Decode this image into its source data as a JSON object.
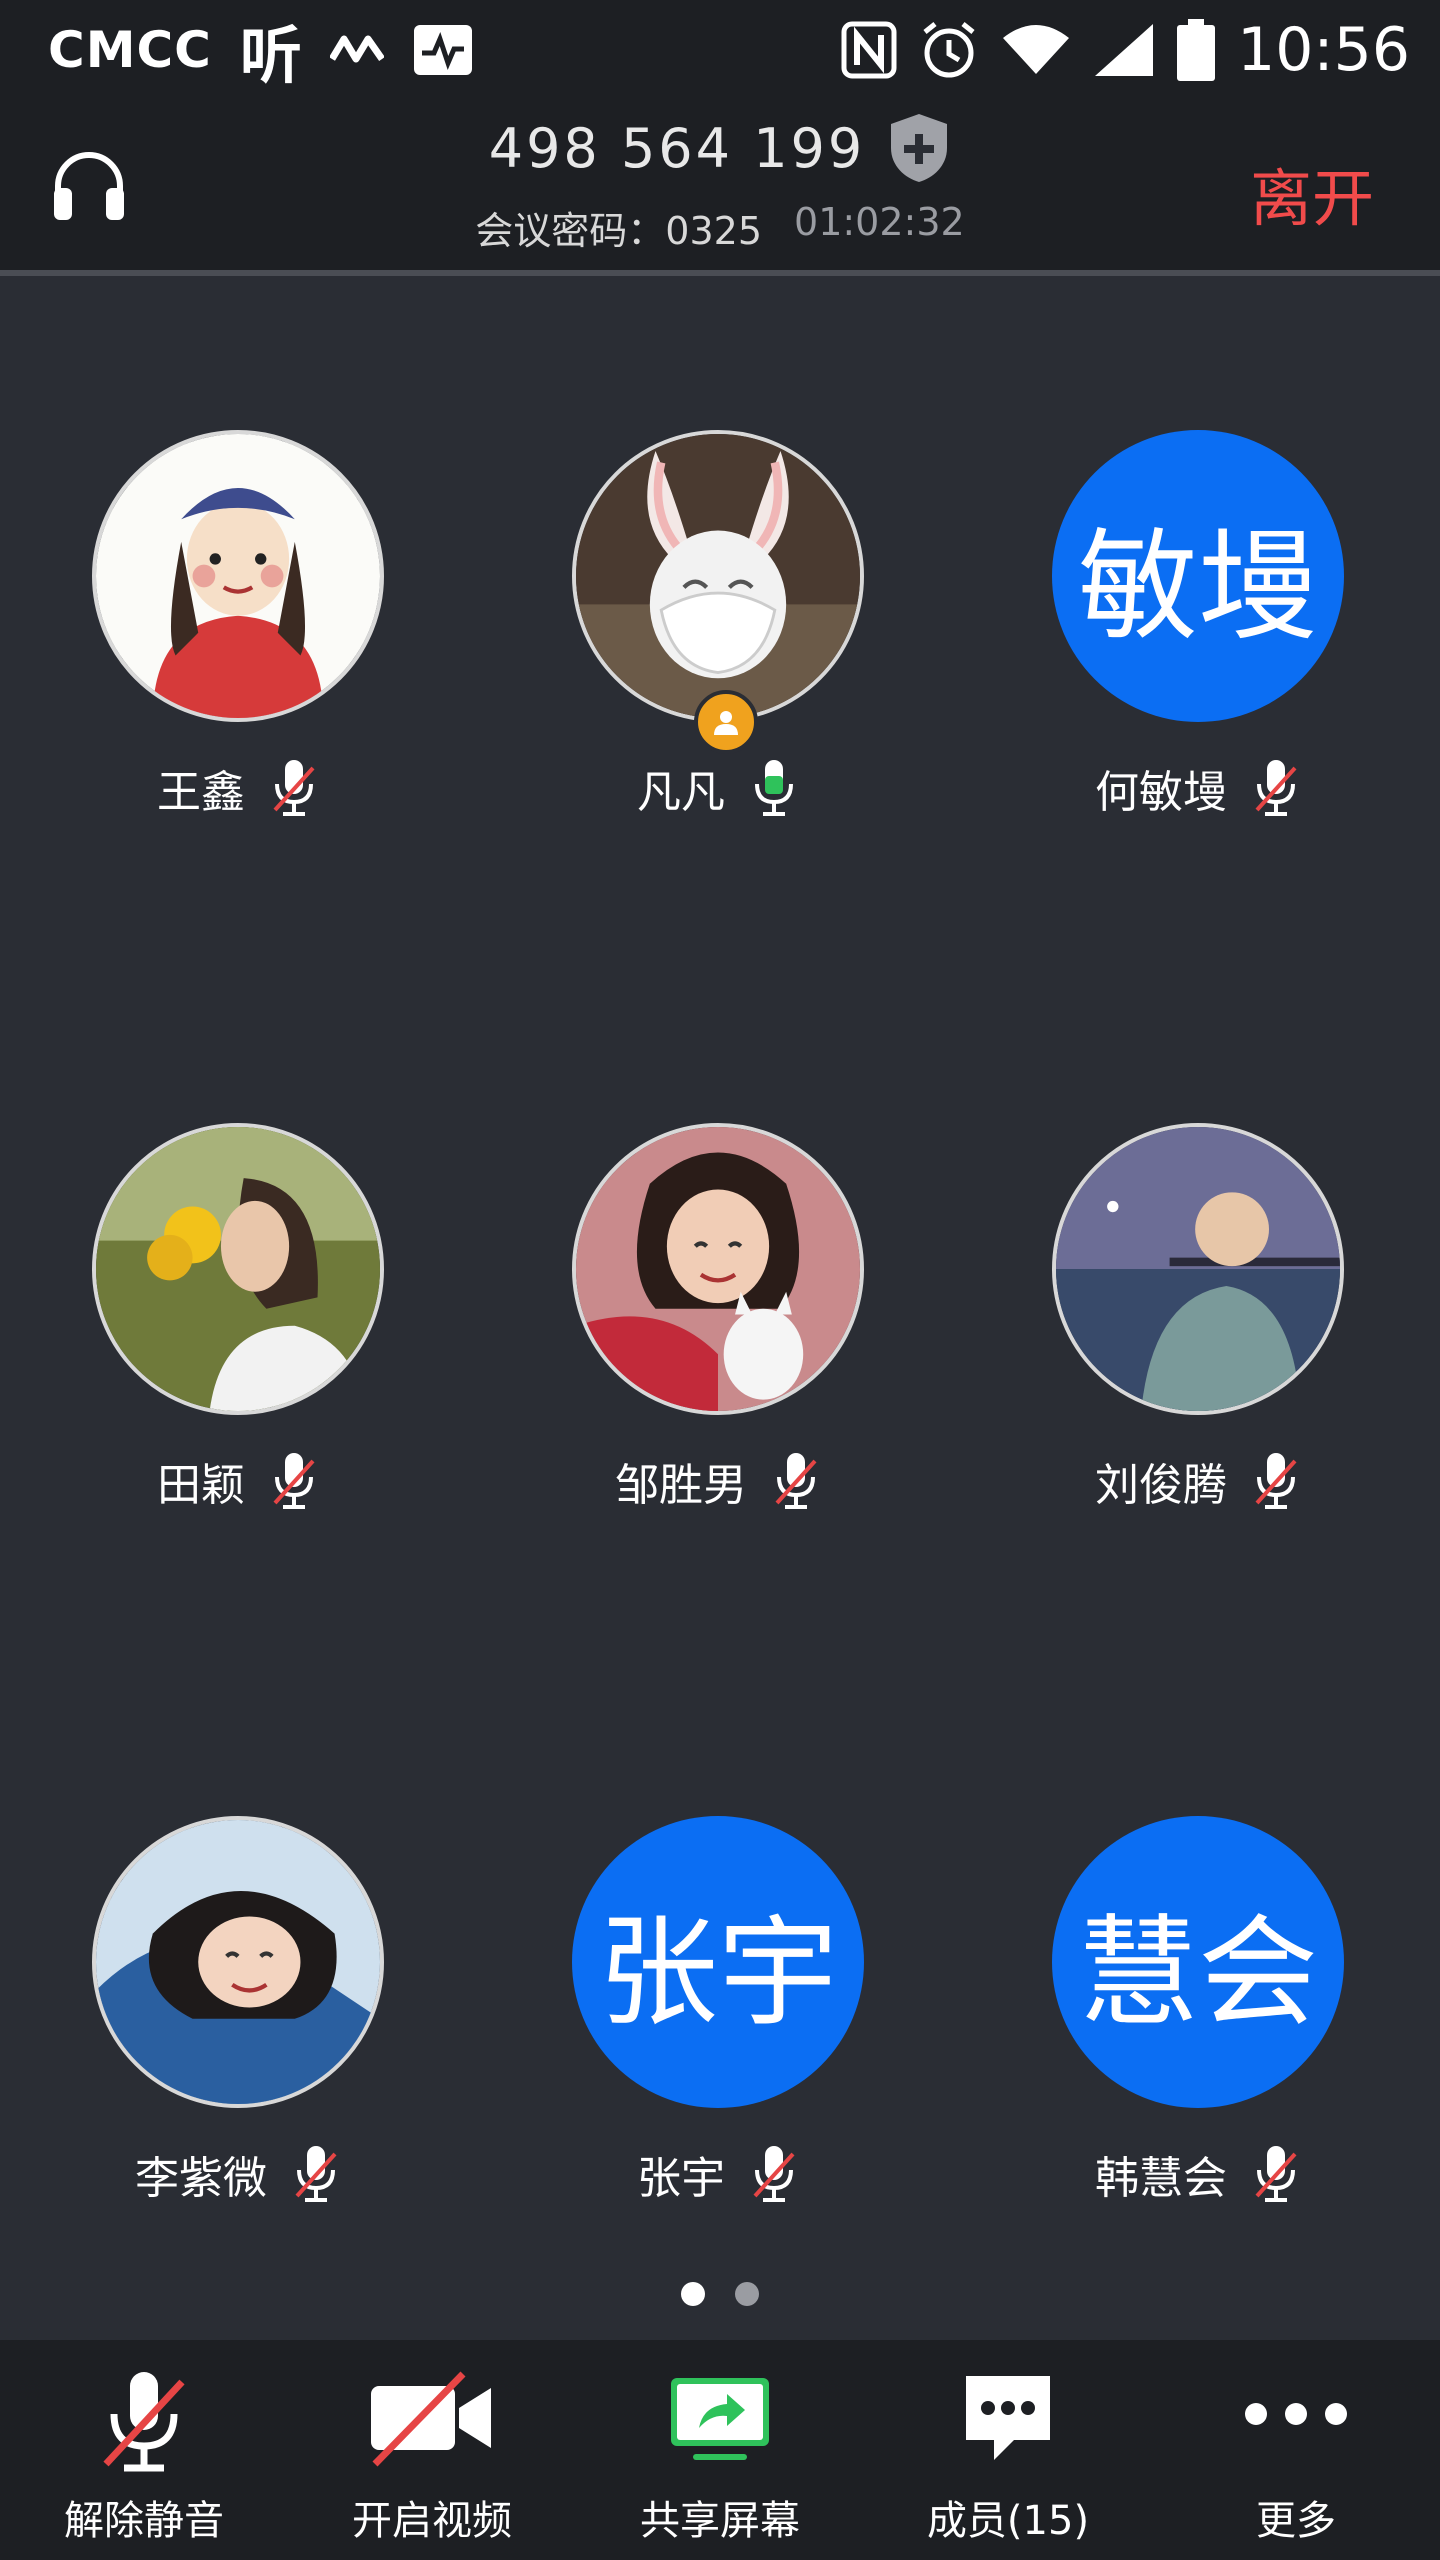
{
  "status_bar": {
    "carrier": "CMCC",
    "ting": "听",
    "time": "10:56"
  },
  "header": {
    "meeting_id": "498 564 199",
    "password_text": "会议密码：0325",
    "timer": "01:02:32",
    "leave_label": "离开"
  },
  "participants": [
    {
      "name": "王鑫",
      "avatar": "photo-cartoon-girl",
      "mic": "muted"
    },
    {
      "name": "凡凡",
      "avatar": "photo-rabbit",
      "mic": "active",
      "host": true
    },
    {
      "name": "何敏墁",
      "avatar_text": "敏墁",
      "mic": "muted"
    },
    {
      "name": "田颖",
      "avatar": "photo-sunflower",
      "mic": "muted"
    },
    {
      "name": "邹胜男",
      "avatar": "photo-girl-cat",
      "mic": "muted"
    },
    {
      "name": "刘俊腾",
      "avatar": "photo-seaside",
      "mic": "muted"
    },
    {
      "name": "李紫微",
      "avatar": "photo-girl-snow",
      "mic": "muted"
    },
    {
      "name": "张宇",
      "avatar_text": "张宇",
      "mic": "muted"
    },
    {
      "name": "韩慧会",
      "avatar_text": "慧会",
      "mic": "muted"
    }
  ],
  "pagination": {
    "total": 2,
    "current": 1
  },
  "toolbar": {
    "unmute": "解除静音",
    "video": "开启视频",
    "share": "共享屏幕",
    "members": "成员(15)",
    "more": "更多"
  },
  "colors": {
    "accent_blue": "#0b6ef3",
    "leave_red": "#f14b4b",
    "host_orange": "#f0a21e",
    "share_green": "#2fc25b"
  }
}
